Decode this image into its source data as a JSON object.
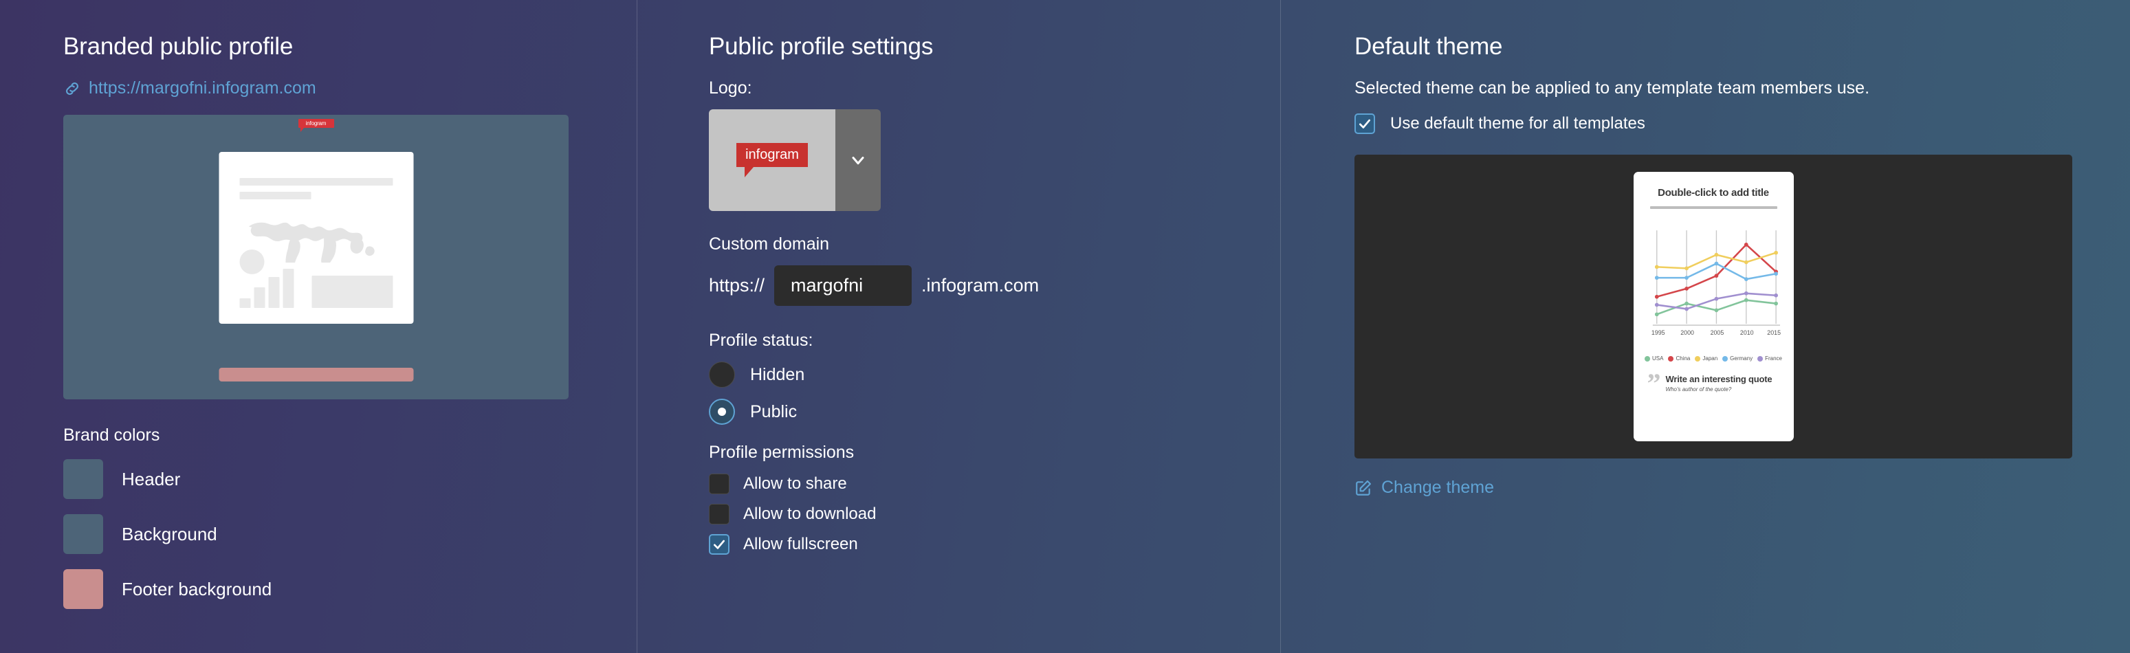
{
  "left": {
    "title": "Branded public profile",
    "profile_url": "https://margofni.infogram.com",
    "link_icon": "link-icon",
    "preview": {
      "badge_text": "infogram"
    },
    "brand_colors_title": "Brand colors",
    "brand_colors": [
      {
        "label": "Header",
        "color": "#4d6478"
      },
      {
        "label": "Background",
        "color": "#4d6478"
      },
      {
        "label": "Footer background",
        "color": "#c98e8e"
      }
    ]
  },
  "middle": {
    "title": "Public profile settings",
    "logo_label": "Logo:",
    "logo_text": "infogram",
    "logo_caret_icon": "chevron-down-icon",
    "custom_domain_label": "Custom domain",
    "domain_prefix": "https://",
    "domain_value": "margofni",
    "domain_placeholder": "margofni",
    "domain_suffix": ".infogram.com",
    "profile_status_label": "Profile status:",
    "status_options": [
      {
        "label": "Hidden",
        "checked": false
      },
      {
        "label": "Public",
        "checked": true
      }
    ],
    "profile_permissions_label": "Profile permissions",
    "permissions": [
      {
        "label": "Allow to share",
        "checked": false
      },
      {
        "label": "Allow to download",
        "checked": false
      },
      {
        "label": "Allow fullscreen",
        "checked": true
      }
    ]
  },
  "right": {
    "title": "Default theme",
    "description": "Selected theme can be applied to any template team members use.",
    "use_default_label": "Use default theme for all templates",
    "use_default_checked": true,
    "change_theme_label": "Change theme",
    "change_theme_icon": "edit-square-icon",
    "slide": {
      "title": "Double-click to add title",
      "quote_main": "Write an interesting quote",
      "quote_sub": "Who's author of the quote?",
      "quote_icon": "quote-mark-icon"
    }
  },
  "chart_data": {
    "type": "line",
    "title": "Double-click to add title",
    "xlabel": "",
    "ylabel": "",
    "x": [
      1995,
      2000,
      2005,
      2010,
      2015
    ],
    "categories": [
      "1995",
      "2000",
      "2005",
      "2010",
      "2015"
    ],
    "xlim": [
      1995,
      2015
    ],
    "ylim": [
      0,
      100
    ],
    "grid": "vertical",
    "legend_position": "bottom",
    "series": [
      {
        "name": "USA",
        "color": "#82c49b",
        "values": [
          10,
          32,
          22,
          36,
          32
        ]
      },
      {
        "name": "China",
        "color": "#d4464a",
        "values": [
          40,
          50,
          62,
          94,
          67
        ]
      },
      {
        "name": "Japan",
        "color": "#f0ce5d",
        "values": [
          72,
          70,
          84,
          77,
          85
        ]
      },
      {
        "name": "Germany",
        "color": "#74b9e8",
        "values": [
          62,
          62,
          77,
          60,
          65
        ]
      },
      {
        "name": "France",
        "color": "#a08fcf",
        "values": [
          31,
          26,
          38,
          47,
          44
        ]
      }
    ]
  },
  "colors": {
    "accent_link": "#5fa3d4",
    "brand_red": "#c8322f",
    "panel_dark": "#2b2b2b",
    "input_dark": "#2c2c2c"
  }
}
